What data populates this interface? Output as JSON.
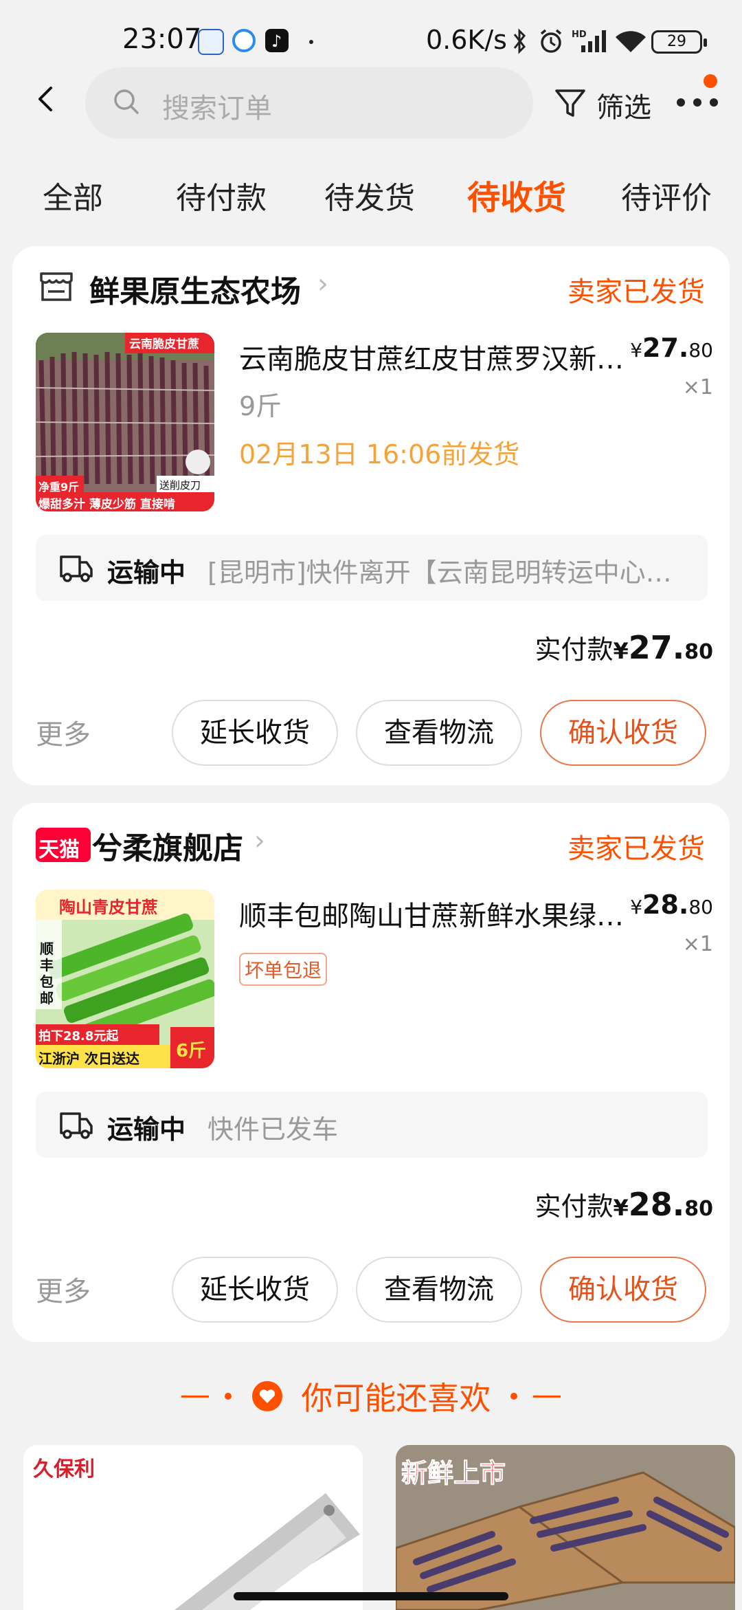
{
  "status_bar": {
    "time": "23:07",
    "speed": "0.6K/s",
    "battery": "29"
  },
  "header": {
    "search_placeholder": "搜索订单",
    "filter_label": "筛选"
  },
  "tabs": [
    {
      "label": "全部"
    },
    {
      "label": "待付款"
    },
    {
      "label": "待发货"
    },
    {
      "label": "待收货"
    },
    {
      "label": "待评价"
    }
  ],
  "orders": [
    {
      "shop_name": "鲜果原生态农场",
      "status": "卖家已发货",
      "title": "云南脆皮甘蔗红皮甘蔗罗汉新鲜应季水果",
      "price_symbol": "¥",
      "price_int": "27.",
      "price_cents": "80",
      "qty": "×1",
      "spec": "9斤",
      "ship_deadline": "02月13日 16:06前发货",
      "thumb_badge": "云南脆皮甘蔗",
      "thumb_weight": "净重9斤",
      "thumb_knife": "送削皮刀",
      "thumb_slogan": "爆甜多汁 薄皮少筋 直接啃",
      "logistics_status": "运输中",
      "logistics_detail": "[昆明市]快件离开【云南昆明转运中心】已发往",
      "paid_label": "实付款",
      "paid_symbol": "¥",
      "paid_int": "27.",
      "paid_cents": "80",
      "more": "更多",
      "btn_extend": "延长收货",
      "btn_track": "查看物流",
      "btn_confirm": "确认收货"
    },
    {
      "shop_badge": "天猫",
      "shop_name": "兮柔旗舰店",
      "status": "卖家已发货",
      "title": "顺丰包邮陶山甘蔗新鲜水果绿皮青皮甘蔗",
      "price_symbol": "¥",
      "price_int": "28.",
      "price_cents": "80",
      "qty": "×1",
      "tag": "坏单包退",
      "thumb_title": "陶山青皮甘蔗",
      "thumb_sf": "顺丰包邮",
      "thumb_price": "拍下28.8元起",
      "thumb_bottom": "江浙沪 次日送达",
      "thumb_weight": "6斤",
      "logistics_status": "运输中",
      "logistics_detail": "快件已发车",
      "paid_label": "实付款",
      "paid_symbol": "¥",
      "paid_int": "28.",
      "paid_cents": "80",
      "more": "更多",
      "btn_extend": "延长收货",
      "btn_track": "查看物流",
      "btn_confirm": "确认收货"
    }
  ],
  "recommend": {
    "title": "你可能还喜欢",
    "items": [
      {
        "brand": "久保利"
      },
      {
        "badge": "新鲜上市"
      }
    ]
  },
  "colors": {
    "accent": "#ff5000",
    "ship_time": "#f4a23a",
    "tmall": "#ff0036"
  }
}
